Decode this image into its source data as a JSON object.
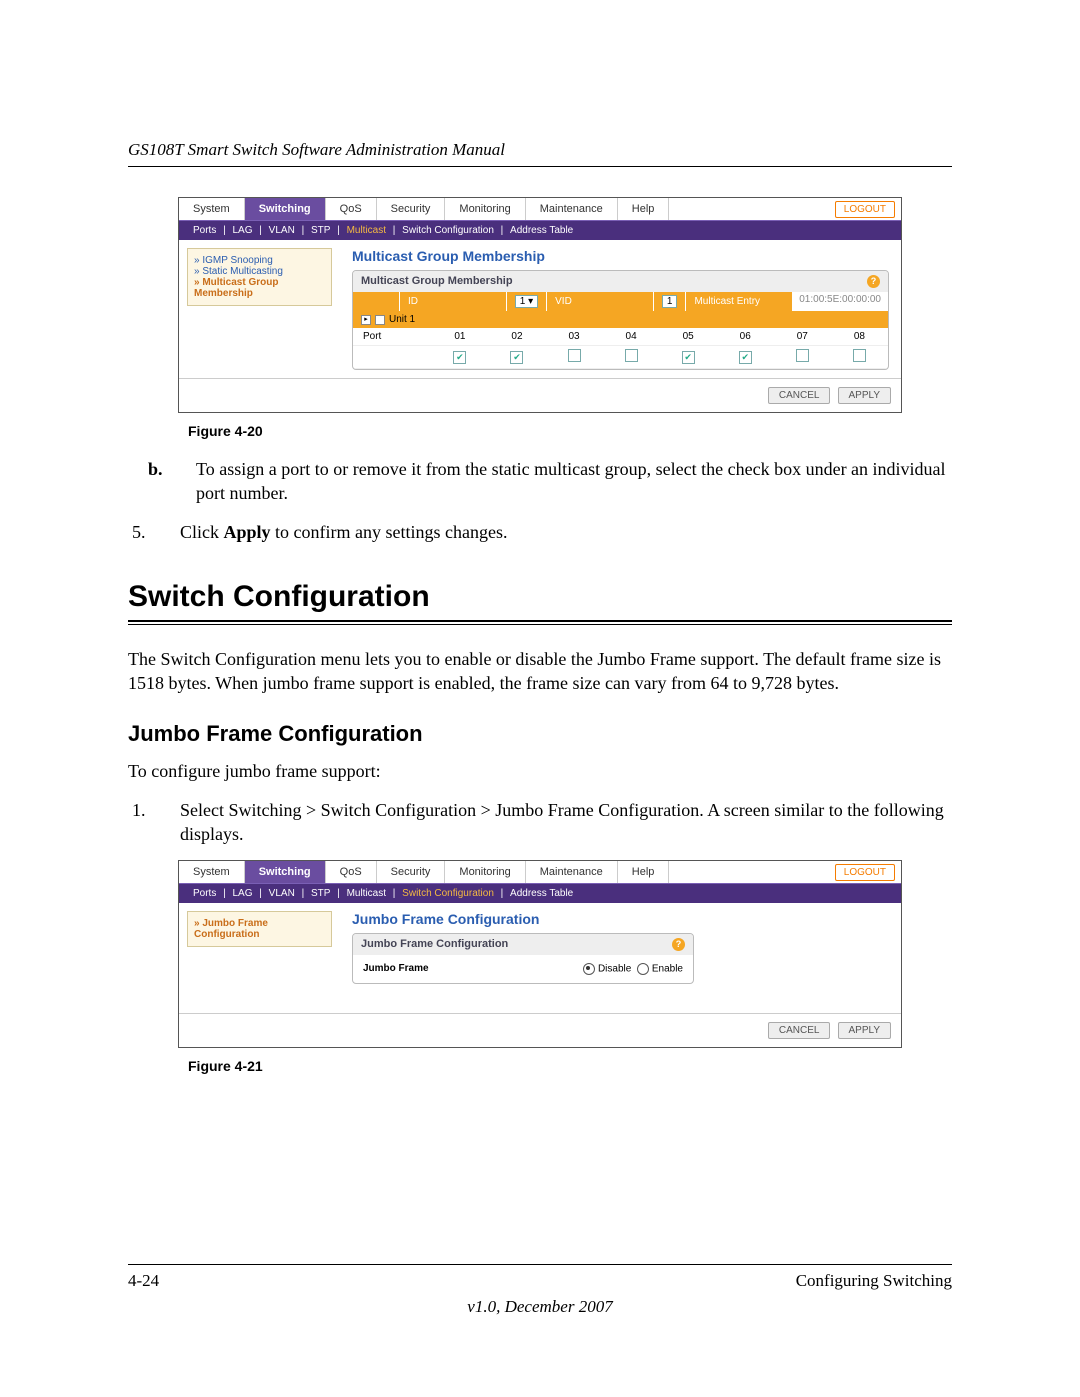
{
  "header": "GS108T Smart Switch Software Administration Manual",
  "tabs": [
    "System",
    "Switching",
    "QoS",
    "Security",
    "Monitoring",
    "Maintenance",
    "Help"
  ],
  "logout": "LOGOUT",
  "subnav": [
    "Ports",
    "LAG",
    "VLAN",
    "STP",
    "Multicast",
    "Switch Configuration",
    "Address Table"
  ],
  "fig1": {
    "side": [
      "IGMP Snooping",
      "Static Multicasting",
      "Multicast Group Membership"
    ],
    "title": "Multicast Group Membership",
    "panelTitle": "Multicast Group Membership",
    "idLbl": "ID",
    "idVal": "1",
    "vidLbl": "VID",
    "vidVal": "1",
    "meLbl": "Multicast Entry",
    "meVal": "01:00:5E:00:00:00",
    "unit": "Unit 1",
    "portLbl": "Port",
    "ports": [
      "01",
      "02",
      "03",
      "04",
      "05",
      "06",
      "07",
      "08"
    ],
    "checks": [
      true,
      true,
      false,
      false,
      true,
      true,
      false,
      false
    ],
    "cancel": "CANCEL",
    "apply": "APPLY"
  },
  "figcap1": "Figure 4-20",
  "stepB": {
    "mk": "b.",
    "txt": "To assign a port to or remove it from the static multicast group, select the check box under an individual port number."
  },
  "step5": {
    "mk": "5.",
    "pre": "Click ",
    "bold": "Apply",
    "post": " to confirm any settings changes."
  },
  "h1": "Switch Configuration",
  "p1": "The Switch Configuration menu lets you to enable or disable the Jumbo Frame support. The default frame size is 1518 bytes. When jumbo frame support is enabled, the frame size can vary from 64 to 9,728 bytes.",
  "h2": "Jumbo Frame Configuration",
  "p2": "To configure jumbo frame support:",
  "step1": {
    "mk": "1.",
    "txt": "Select Switching > Switch Configuration > Jumbo Frame Configuration. A screen similar to the following displays."
  },
  "fig2": {
    "side": [
      "Jumbo Frame Configuration"
    ],
    "title": "Jumbo Frame Configuration",
    "panelTitle": "Jumbo Frame Configuration",
    "lbl": "Jumbo Frame",
    "opt1": "Disable",
    "opt2": "Enable",
    "cancel": "CANCEL",
    "apply": "APPLY"
  },
  "figcap2": "Figure 4-21",
  "footL": "4-24",
  "footR": "Configuring Switching",
  "ver": "v1.0, December 2007"
}
